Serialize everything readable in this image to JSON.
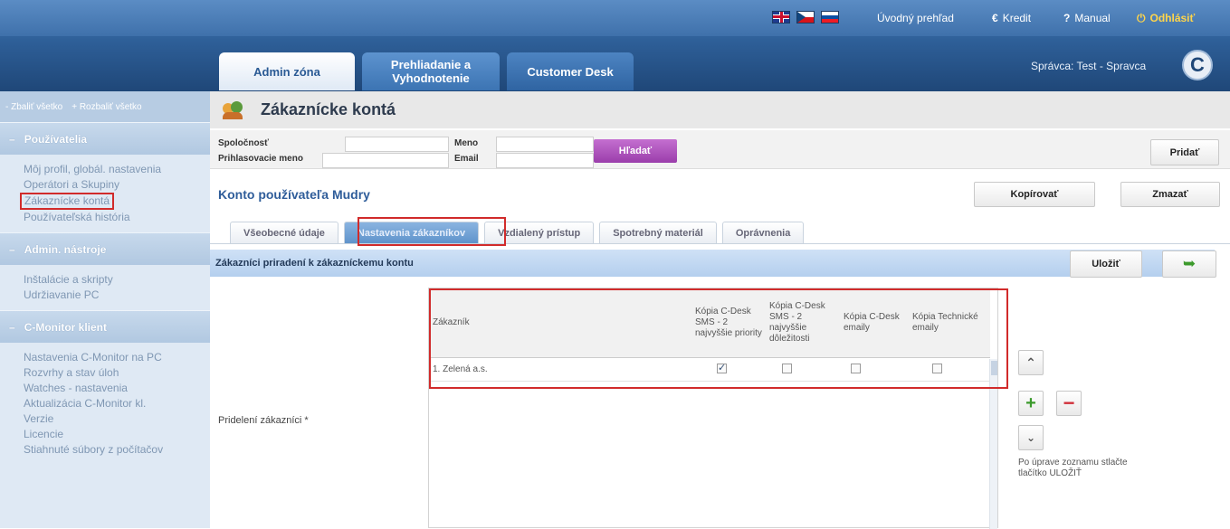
{
  "header": {
    "links": {
      "overview": "Úvodný prehľad",
      "credit": "Kredit",
      "manual": "Manual",
      "logout": "Odhlásiť"
    },
    "tabs": [
      "Admin zóna",
      "Prehliadanie a Vyhodnotenie",
      "Customer Desk"
    ],
    "admin_label": "Správca: Test - Spravca",
    "logo": "C"
  },
  "sidebar": {
    "collapse_all": "- Zbaliť všetko",
    "expand_all": "+ Rozbaliť všetko",
    "sections": [
      {
        "title": "Používatelia",
        "items": [
          "Môj profil, globál. nastavenia",
          "Operátori a Skupiny",
          "Zákaznícke kontá",
          "Používateľská história"
        ]
      },
      {
        "title": "Admin. nástroje",
        "items": [
          "Inštalácie a skripty",
          "Udržiavanie PC"
        ]
      },
      {
        "title": "C-Monitor klient",
        "items": [
          "Nastavenia C-Monitor na PC",
          "Rozvrhy a stav úloh",
          "Watches - nastavenia",
          "Aktualizácia C-Monitor kl.",
          "Verzie",
          "Licencie",
          "Stiahnuté súbory z počítačov"
        ]
      }
    ]
  },
  "page": {
    "title": "Zákaznícke kontá",
    "search": {
      "company_label": "Spoločnosť",
      "login_label": "Prihlasovacie meno",
      "name_label": "Meno",
      "email_label": "Email",
      "search_button": "Hľadať",
      "add_button": "Pridať"
    },
    "account_title": "Konto používateľa Mudry",
    "copy_button": "Kopírovať",
    "delete_button": "Zmazať",
    "subtabs": [
      "Všeobecné údaje",
      "Nastavenia zákazníkov",
      "Vzdialený prístup",
      "Spotrebný materiál",
      "Oprávnenia"
    ],
    "section_title": "Zákazníci priradení k zákazníckemu kontu",
    "save_button": "Uložiť",
    "assigned_label": "Pridelení zákazníci *",
    "table": {
      "columns": [
        "Zákazník",
        "Kópia C-Desk SMS - 2 najvyššie priority",
        "Kópia C-Desk SMS - 2 najvyššie dôležitosti",
        "Kópia C-Desk emaily",
        "Kópia Technické emaily"
      ],
      "rows": [
        {
          "name": "1. Zelená a.s.",
          "checks": [
            true,
            false,
            false,
            false
          ]
        }
      ]
    },
    "hint": "Po úprave zoznamu stlačte tlačítko ULOŽIŤ"
  }
}
